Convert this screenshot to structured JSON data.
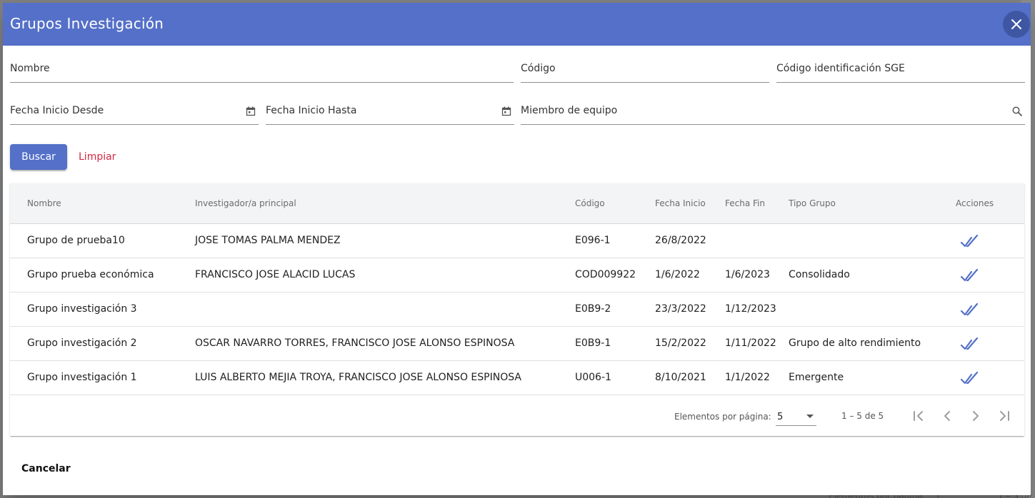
{
  "dialog": {
    "title": "Grupos Investigación",
    "close_icon": "close-icon"
  },
  "filters": {
    "nombre": "Nombre",
    "codigo": "Código",
    "codigo_sge": "Código identificación SGE",
    "fecha_desde": "Fecha Inicio Desde",
    "fecha_hasta": "Fecha Inicio Hasta",
    "miembro": "Miembro de equipo"
  },
  "actions": {
    "buscar": "Buscar",
    "limpiar": "Limpiar",
    "cancelar": "Cancelar"
  },
  "table": {
    "columns": [
      "Nombre",
      "Investigador/a principal",
      "Código",
      "Fecha Inicio",
      "Fecha Fin",
      "Tipo Grupo",
      "Acciones"
    ],
    "rows": [
      {
        "nombre": "Grupo de prueba10",
        "investigador": "JOSE TOMAS PALMA MENDEZ",
        "codigo": "E096-1",
        "fecha_inicio": "26/8/2022",
        "fecha_fin": "",
        "tipo": ""
      },
      {
        "nombre": "Grupo prueba económica",
        "investigador": "FRANCISCO JOSE ALACID LUCAS",
        "codigo": "COD009922",
        "fecha_inicio": "1/6/2022",
        "fecha_fin": "1/6/2023",
        "tipo": "Consolidado"
      },
      {
        "nombre": "Grupo investigación 3",
        "investigador": "",
        "codigo": "E0B9-2",
        "fecha_inicio": "23/3/2022",
        "fecha_fin": "1/12/2023",
        "tipo": ""
      },
      {
        "nombre": "Grupo investigación 2",
        "investigador": "OSCAR NAVARRO TORRES, FRANCISCO JOSE ALONSO ESPINOSA",
        "codigo": "E0B9-1",
        "fecha_inicio": "15/2/2022",
        "fecha_fin": "1/11/2022",
        "tipo": "Grupo de alto rendimiento"
      },
      {
        "nombre": "Grupo investigación 1",
        "investigador": "LUIS ALBERTO MEJIA TROYA, FRANCISCO JOSE ALONSO ESPINOSA",
        "codigo": "U006-1",
        "fecha_inicio": "8/10/2021",
        "fecha_fin": "1/1/2022",
        "tipo": "Emergente"
      }
    ]
  },
  "paginator": {
    "label": "Elementos por página:",
    "page_size": "5",
    "range": "1 – 5 de 5"
  },
  "background": {
    "footer_label": "Elementos por página:",
    "footer_size": "5",
    "footer_range": "1 – 5 de"
  },
  "colors": {
    "header": "#5470c8",
    "accent": "#5470c8",
    "warn": "#d4283f"
  }
}
